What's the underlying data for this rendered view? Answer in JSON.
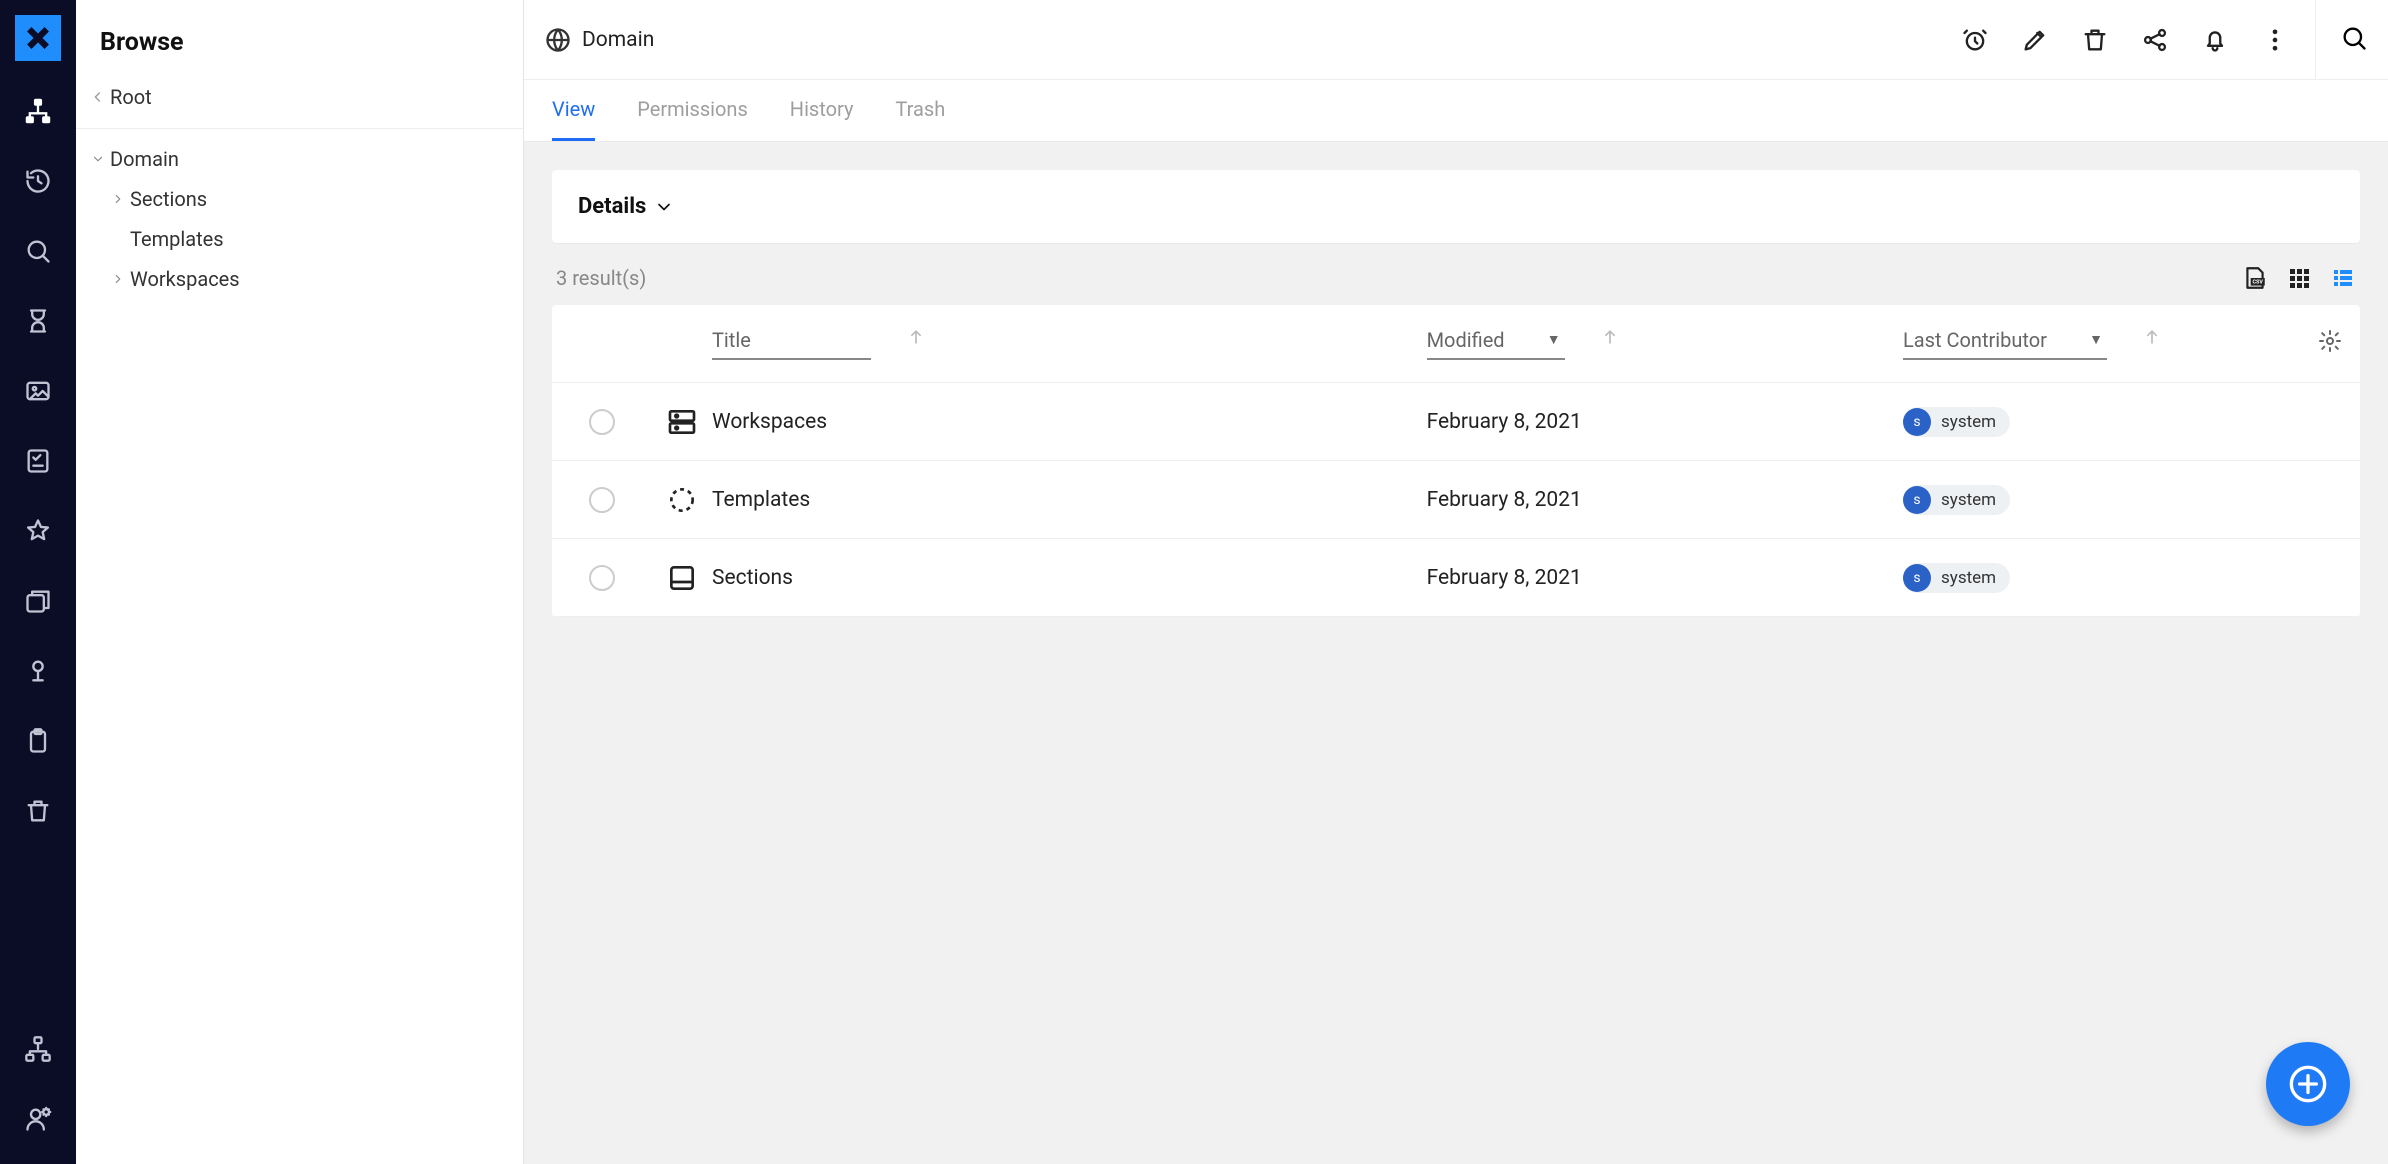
{
  "rail": {
    "items_top": [
      {
        "name": "sitemap-icon",
        "active": true
      },
      {
        "name": "history-icon"
      },
      {
        "name": "search-icon"
      },
      {
        "name": "hourglass-icon"
      },
      {
        "name": "image-icon"
      },
      {
        "name": "checklist-icon"
      },
      {
        "name": "star-icon"
      },
      {
        "name": "collections-icon"
      },
      {
        "name": "push-pin-icon"
      },
      {
        "name": "clipboard-icon"
      },
      {
        "name": "trash-icon"
      }
    ],
    "items_bottom": [
      {
        "name": "admin-tree-icon"
      },
      {
        "name": "user-settings-icon"
      }
    ]
  },
  "sidebar": {
    "title": "Browse",
    "breadcrumb_parent": "Root",
    "tree": {
      "root_label": "Domain",
      "children": [
        {
          "label": "Sections",
          "has_children": true
        },
        {
          "label": "Templates",
          "has_children": false
        },
        {
          "label": "Workspaces",
          "has_children": true
        }
      ]
    }
  },
  "topbar": {
    "title": "Domain"
  },
  "tabs": [
    {
      "label": "View",
      "active": true
    },
    {
      "label": "Permissions"
    },
    {
      "label": "History"
    },
    {
      "label": "Trash"
    }
  ],
  "details": {
    "header": "Details"
  },
  "results": {
    "count_text": "3 result(s)"
  },
  "table": {
    "columns": {
      "title": "Title",
      "modified": "Modified",
      "contributor": "Last Contributor"
    },
    "rows": [
      {
        "title": "Workspaces",
        "modified": "February 8, 2021",
        "contributor": "system",
        "avatar_initial": "s",
        "icon": "workspaces-icon"
      },
      {
        "title": "Templates",
        "modified": "February 8, 2021",
        "contributor": "system",
        "avatar_initial": "s",
        "icon": "templates-icon"
      },
      {
        "title": "Sections",
        "modified": "February 8, 2021",
        "contributor": "system",
        "avatar_initial": "s",
        "icon": "sections-icon"
      }
    ]
  }
}
